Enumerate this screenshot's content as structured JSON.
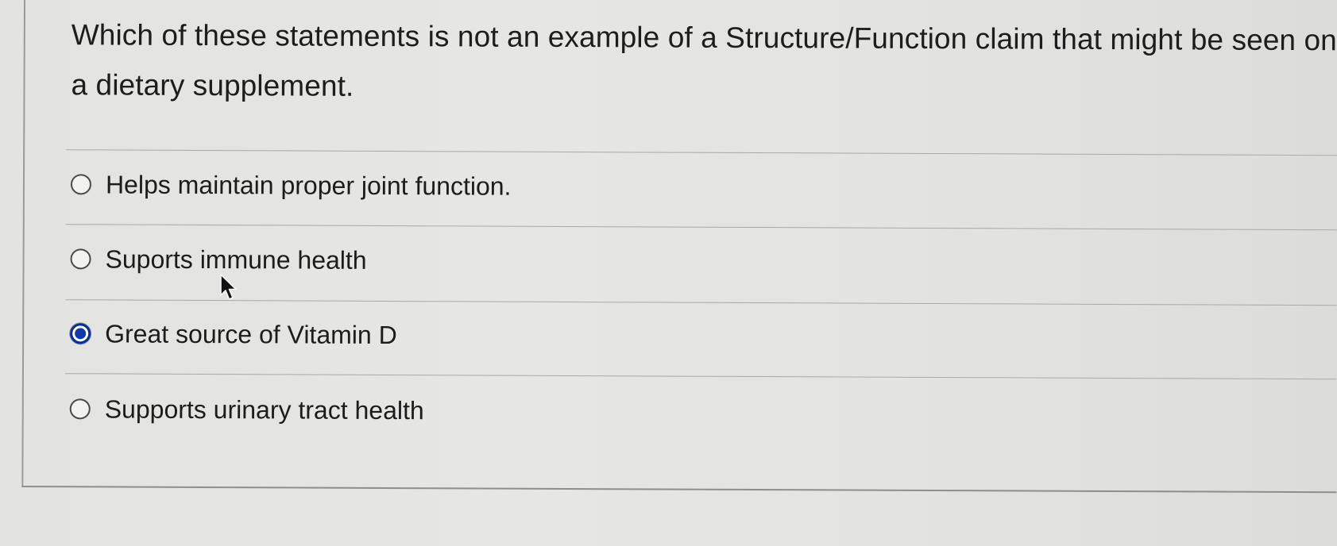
{
  "question": {
    "text": "Which of these statements is not an example of a Structure/Function claim that might be seen on a dietary supplement."
  },
  "options": [
    {
      "label": "Helps maintain proper joint function.",
      "selected": false
    },
    {
      "label": "Suports immune health",
      "selected": false
    },
    {
      "label": "Great source of Vitamin D",
      "selected": true
    },
    {
      "label": "Supports urinary tract health",
      "selected": false
    }
  ],
  "colors": {
    "selected_radio": "#0d3aa8",
    "background": "#e4e4e2"
  },
  "icons": {
    "pointer": "mouse-pointer-icon"
  }
}
